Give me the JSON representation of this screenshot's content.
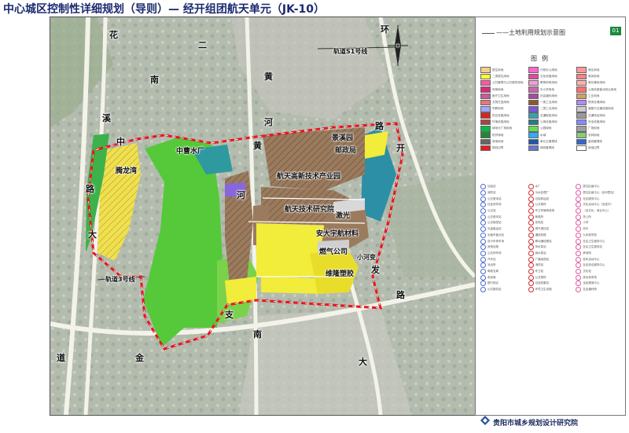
{
  "header": {
    "title": "中心城区控制性详细规划（导则）— 经开组团航天单元（JK-10）"
  },
  "panel": {
    "subtitle": "——土地利用规划示意图",
    "sheet_no": "01",
    "legend_title": "图例",
    "landuse_items": [
      {
        "color": "#f5d08a",
        "label": "居住用地"
      },
      {
        "color": "#ff66cc",
        "label": "行政办公用地"
      },
      {
        "color": "#ff9999",
        "label": "商业用地"
      },
      {
        "color": "#ffff33",
        "label": "二类居住用地"
      },
      {
        "color": "#e04aa0",
        "label": "文化设施用地"
      },
      {
        "color": "#ff8080",
        "label": "商务用地"
      },
      {
        "color": "#ff55aa",
        "label": "公共管理与公共服务用地"
      },
      {
        "color": "#f0a0d0",
        "label": "教育科研用地"
      },
      {
        "color": "#ffb0b0",
        "label": "娱乐康体用地"
      },
      {
        "color": "#d92a7a",
        "label": "体育用地"
      },
      {
        "color": "#cc66aa",
        "label": "中小学用地"
      },
      {
        "color": "#ff7070",
        "label": "公用设施营业网点用地"
      },
      {
        "color": "#c85a9a",
        "label": "医疗卫生用地"
      },
      {
        "color": "#a64aa0",
        "label": "社会福利用地"
      },
      {
        "color": "#d4a060",
        "label": "工业用地"
      },
      {
        "color": "#e87878",
        "label": "文物古迹用地"
      },
      {
        "color": "#8a5a2e",
        "label": "一类工业用地"
      },
      {
        "color": "#b08aff",
        "label": "物流仓储用地"
      },
      {
        "color": "#9aa8ff",
        "label": "宗教用地"
      },
      {
        "color": "#7a58d8",
        "label": "二类工业用地"
      },
      {
        "color": "#cccccc",
        "label": "道路与交通设施用地"
      },
      {
        "color": "#dd2222",
        "label": "供应设施用地"
      },
      {
        "color": "#3aa0b0",
        "label": "交通枢纽用地"
      },
      {
        "color": "#999999",
        "label": "交通场站用地"
      },
      {
        "color": "#aa4444",
        "label": "环境设施用地"
      },
      {
        "color": "#2a7a88",
        "label": "公用设施用地"
      },
      {
        "color": "#8888ff",
        "label": "安全设施用地"
      },
      {
        "color": "#00bb44",
        "label": "绿地与广场用地"
      },
      {
        "color": "#66dd55",
        "label": "公园绿地"
      },
      {
        "color": "#a0a0a0",
        "label": "广场用地"
      },
      {
        "color": "#228833",
        "label": "防护绿地"
      },
      {
        "color": "#33aaff",
        "label": "水域"
      },
      {
        "color": "#88cc77",
        "label": "农林用地"
      },
      {
        "color": "#666666",
        "label": "其他用地"
      },
      {
        "color": "#2255aa",
        "label": "单元主管理线"
      },
      {
        "color": "#3366cc",
        "label": "蓝线管理线"
      },
      {
        "color": "#e02020",
        "label": "规划边界"
      },
      {
        "color": "#6677cc",
        "label": "绿线管理线"
      },
      {
        "color": "#ffffff",
        "label": "用地边界"
      }
    ],
    "facility_items": [
      {
        "style": "blue",
        "label": "加油站"
      },
      {
        "style": "red",
        "label": "水厂"
      },
      {
        "style": "pink",
        "label": "居住区级中心"
      },
      {
        "style": "blue",
        "label": "消防站"
      },
      {
        "style": "red",
        "label": "污水处理厂"
      },
      {
        "style": "pink",
        "label": "居住区级中心（含邻里站）"
      },
      {
        "style": "blue",
        "label": "公交首末站"
      },
      {
        "style": "red",
        "label": "垃圾转运站"
      },
      {
        "style": "pink",
        "label": "社区服务中心"
      },
      {
        "style": "blue",
        "label": "社会停车场"
      },
      {
        "style": "red",
        "label": "公共厕所"
      },
      {
        "style": "pink",
        "label": "文化活动中心（含室外）"
      },
      {
        "style": "blue",
        "label": "公交站"
      },
      {
        "style": "red",
        "label": "环卫车辆停放场"
      },
      {
        "style": "pink",
        "label": "（含文化、商业中心）"
      },
      {
        "style": "blue",
        "label": "公交首末站"
      },
      {
        "style": "red",
        "label": "邮政所"
      },
      {
        "style": "pink",
        "label": "托儿所"
      },
      {
        "style": "blue",
        "label": "公交枢纽站"
      },
      {
        "style": "red",
        "label": "变电站"
      },
      {
        "style": "pink",
        "label": "小学"
      },
      {
        "style": "blue",
        "label": "长途客运站"
      },
      {
        "style": "red",
        "label": "燃气调压站"
      },
      {
        "style": "pink",
        "label": "初中"
      },
      {
        "style": "blue",
        "label": "出租车营业站"
      },
      {
        "style": "red",
        "label": "通信机楼"
      },
      {
        "style": "pink",
        "label": "九年制学校"
      },
      {
        "style": "blue",
        "label": "自行车停车场"
      },
      {
        "style": "red",
        "label": "移动通信基站"
      },
      {
        "style": "pink",
        "label": "社区卫生服务中心"
      },
      {
        "style": "blue",
        "label": "其他设施"
      },
      {
        "style": "red",
        "label": "排水泵站"
      },
      {
        "style": "pink",
        "label": "社区卫生服务站"
      },
      {
        "style": "blue",
        "label": "公共停车场"
      },
      {
        "style": "red",
        "label": "雨水泵站"
      },
      {
        "style": "pink",
        "label": "养老院"
      },
      {
        "style": "blue",
        "label": "汽车站"
      },
      {
        "style": "red",
        "label": "广播电视站"
      },
      {
        "style": "pink",
        "label": "老年活动中心"
      },
      {
        "style": "blue",
        "label": "派出所"
      },
      {
        "style": "red",
        "label": "消防站"
      },
      {
        "style": "pink",
        "label": "社区综合服务中心"
      },
      {
        "style": "blue",
        "label": "邮政支局"
      },
      {
        "style": "red",
        "label": "环卫站"
      },
      {
        "style": "pink",
        "label": "文化站"
      },
      {
        "style": "blue",
        "label": "电信局"
      },
      {
        "style": "red",
        "label": "公共厕所"
      },
      {
        "style": "pink",
        "label": "综合体育场"
      },
      {
        "style": "blue",
        "label": "银行网点"
      },
      {
        "style": "red",
        "label": "垃圾收集站"
      },
      {
        "style": "pink",
        "label": "全民健身中心"
      },
      {
        "style": "blue",
        "label": "公共服务站"
      },
      {
        "style": "red",
        "label": "环境卫生设施"
      },
      {
        "style": "pink",
        "label": "社会福利院"
      }
    ],
    "institute": "贵阳市城乡规划设计研究院"
  },
  "map": {
    "area_labels": {
      "zhongcao": "中曹水厂",
      "jingxi": "景溪园",
      "youzheng": "邮政局",
      "tenglong": "腾龙湾",
      "hangtian_park": "航天高新技术产业园",
      "hangtian_inst": "航天技术研究院",
      "jiguang": "激光",
      "anda": "安大宇航材料",
      "ranqi": "燃气公司",
      "xiaohe": "小河变",
      "weilong": "维隆塑胶"
    },
    "rail_labels": {
      "s1": "轨道S1号线",
      "l3": "轨道3号线"
    },
    "road_chars": {
      "huaxi": [
        "花",
        "南",
        "溪",
        "中",
        "大",
        "道"
      ],
      "erhuan": [
        "二",
        "黄",
        "河",
        "路"
      ],
      "huanlu": [
        "环",
        "路",
        "开",
        "发"
      ],
      "jinzhu": [
        "金",
        "南",
        "支",
        "大"
      ],
      "huanghe_mid": [
        "黄",
        "河"
      ],
      "lu2": [
        "路"
      ]
    }
  }
}
